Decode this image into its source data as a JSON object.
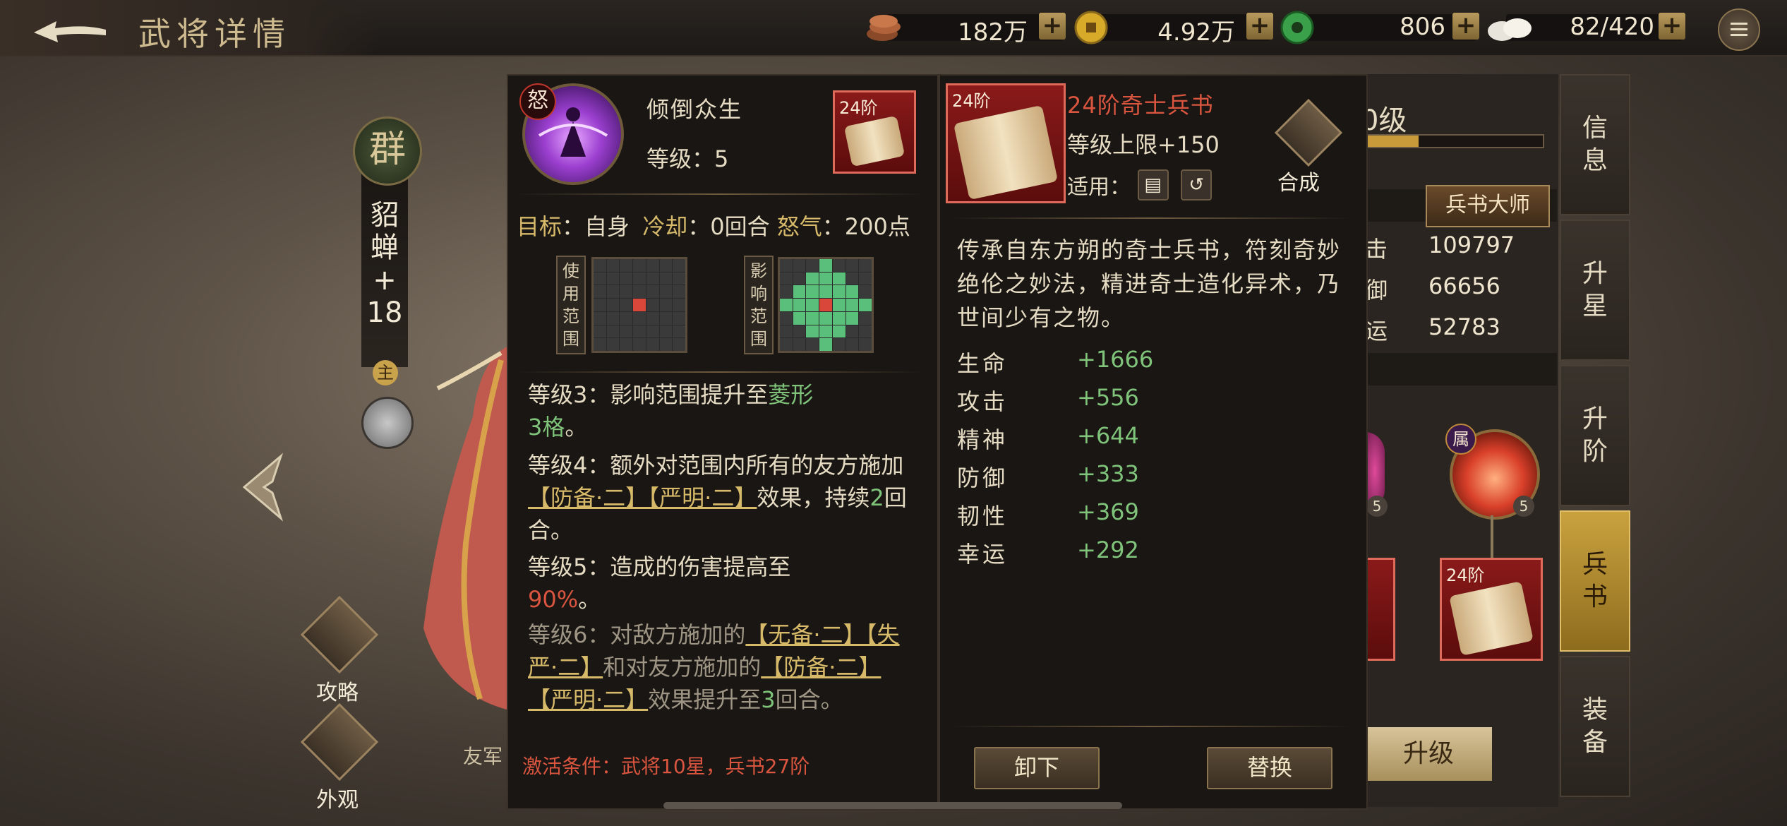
{
  "header": {
    "title": "武将详情",
    "resources": [
      {
        "icon": "copper-coins-icon",
        "value": "182万"
      },
      {
        "icon": "gold-coin-icon",
        "value": "4.92万"
      },
      {
        "icon": "jade-icon",
        "value": "806"
      },
      {
        "icon": "food-bun-icon",
        "value": "82/420"
      }
    ],
    "plus": "+"
  },
  "hero": {
    "faction": "群",
    "name_chars": [
      "貂",
      "蝉",
      "+",
      "18"
    ],
    "main_badge": "主"
  },
  "left_buttons": {
    "strategy": "攻略",
    "appearance": "外观"
  },
  "ally_text": "友军",
  "skill": {
    "badge": "怒",
    "name": "倾倒众生",
    "level": "等级：5",
    "book_tier": "24阶",
    "target_label": "目标",
    "target_value": "：自身",
    "cooldown_label": "冷却",
    "cooldown_value": "：0回合",
    "rage_label": "怒气",
    "rage_value": "：200点",
    "use_range": [
      "使",
      "用",
      "范",
      "围"
    ],
    "effect_range": [
      "影",
      "响",
      "范",
      "围"
    ],
    "lv3_a": "等级3：影响范围提升至",
    "lv3_b": "菱形",
    "lv3_c": "3格",
    "lv3_d": "。",
    "lv4_a": "等级4：额外对范围内所有的友方施加",
    "lv4_b": "【防备·二】【严明·二】",
    "lv4_c": "效果，持续",
    "lv4_d": "2",
    "lv4_e": "回合。",
    "lv5_a": "等级5：造成的伤害提高至",
    "lv5_b": "90%",
    "lv5_c": "。",
    "lv6_a": "等级6：对敌方施加的",
    "lv6_b": "【无备·二】【失严·二】",
    "lv6_c": "和对友方施加的",
    "lv6_d": "【防备·二】【严明·二】",
    "lv6_e": "效果提升至",
    "lv6_f": "3",
    "lv6_g": "回合。",
    "activate": "激活条件：武将10星，兵书27阶"
  },
  "book": {
    "tier": "24阶",
    "title": "24阶奇士兵书",
    "cap": "等级上限+150",
    "apply": "适用：",
    "craft": "合成",
    "description": "传承自东方朔的奇士兵书，符刻奇妙绝伦之妙法，精进奇士造化异术，乃世间少有之物。",
    "stats": [
      {
        "name": "生命",
        "value": "+1666"
      },
      {
        "name": "攻击",
        "value": "+556"
      },
      {
        "name": "精神",
        "value": "+644"
      },
      {
        "name": "防御",
        "value": "+333"
      },
      {
        "name": "韧性",
        "value": "+369"
      },
      {
        "name": "幸运",
        "value": "+292"
      }
    ],
    "unequip": "卸下",
    "replace": "替换"
  },
  "right": {
    "level": "0级",
    "level_progress": 0.3,
    "master": "兵书大师",
    "stats": [
      {
        "label": "击",
        "value": "109797"
      },
      {
        "label": "御",
        "value": "66656"
      },
      {
        "label": "运",
        "value": "52783"
      }
    ],
    "attr_badge": "属",
    "slot_level": "5",
    "slot_tier": "24阶",
    "upgrade": "升级"
  },
  "tabs": [
    {
      "label": "信息"
    },
    {
      "label": "升星"
    },
    {
      "label": "升阶"
    },
    {
      "label": "兵书"
    },
    {
      "label": "装备"
    }
  ],
  "colors": {
    "accent_gold": "#c9a23e",
    "red_text": "#d9553f",
    "green_text": "#7fc47a"
  }
}
